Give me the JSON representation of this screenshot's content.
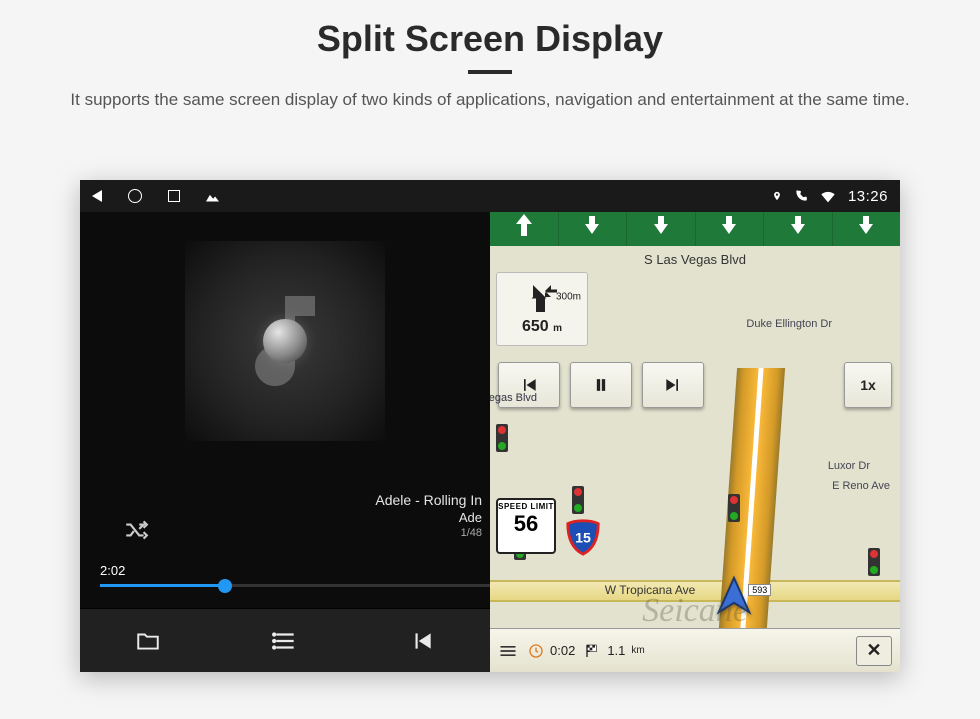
{
  "page": {
    "title": "Split Screen Display",
    "subtitle": "It supports the same screen display of two kinds of applications, navigation and entertainment at the same time."
  },
  "statusbar": {
    "time": "13:26"
  },
  "music": {
    "track_line1": "Adele - Rolling In",
    "track_line2": "Ade",
    "track_count": "1/48",
    "elapsed": "2:02"
  },
  "nav": {
    "top_street": "S Las Vegas Blvd",
    "next_turn_dist": "300",
    "next_turn_unit": "m",
    "hint_dist": "650",
    "hint_unit": "m",
    "speed_label": "SPEED LIMIT",
    "speed_value": "56",
    "interstate": "15",
    "speed_multiplier": "1x",
    "place_duke": "Duke Ellington Dr",
    "place_luxor": "Luxor Dr",
    "place_reno": "E Reno Ave",
    "place_vegas": "Vegas Blvd",
    "bottom_street": "W Tropicana Ave",
    "marker": "593",
    "eta_time": "0:02",
    "eta_dist": "1.1",
    "eta_unit": "km"
  },
  "watermark": "Seicane"
}
